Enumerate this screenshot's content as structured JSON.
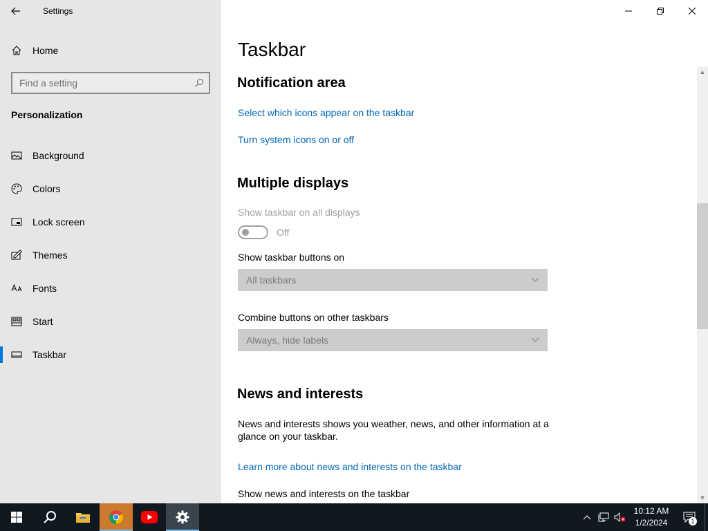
{
  "window": {
    "app_title": "Settings",
    "back_label": "←"
  },
  "sidebar": {
    "home_label": "Home",
    "search_placeholder": "Find a setting",
    "section_title": "Personalization",
    "items": [
      {
        "label": "Background",
        "icon": "picture-icon"
      },
      {
        "label": "Colors",
        "icon": "palette-icon"
      },
      {
        "label": "Lock screen",
        "icon": "lock-screen-icon"
      },
      {
        "label": "Themes",
        "icon": "themes-icon"
      },
      {
        "label": "Fonts",
        "icon": "fonts-icon"
      },
      {
        "label": "Start",
        "icon": "start-icon"
      },
      {
        "label": "Taskbar",
        "icon": "taskbar-icon",
        "active": true
      }
    ]
  },
  "main": {
    "page_title": "Taskbar",
    "notification_area": {
      "heading": "Notification area",
      "link1": "Select which icons appear on the taskbar",
      "link2": "Turn system icons on or off"
    },
    "multiple_displays": {
      "heading": "Multiple displays",
      "show_all_label": "Show taskbar on all displays",
      "toggle_state": "Off",
      "buttons_on_label": "Show taskbar buttons on",
      "buttons_on_value": "All taskbars",
      "combine_label": "Combine buttons on other taskbars",
      "combine_value": "Always, hide labels"
    },
    "news": {
      "heading": "News and interests",
      "description": "News and interests shows you weather, news, and other information at a glance on your taskbar.",
      "learn_more": "Learn more about news and interests on the taskbar",
      "show_label": "Show news and interests on the taskbar"
    }
  },
  "taskbar": {
    "apps": [
      "start-icon",
      "search-icon",
      "file-explorer-icon",
      "chrome-icon",
      "youtube-icon",
      "settings-icon"
    ],
    "clock_time": "10:12 AM",
    "clock_date": "1/2/2024",
    "notification_count": "1"
  },
  "colors": {
    "accent": "#0078d7",
    "link": "#0067b8",
    "sidebar_bg": "#e6e6e6",
    "taskbar_bg": "#101820"
  }
}
